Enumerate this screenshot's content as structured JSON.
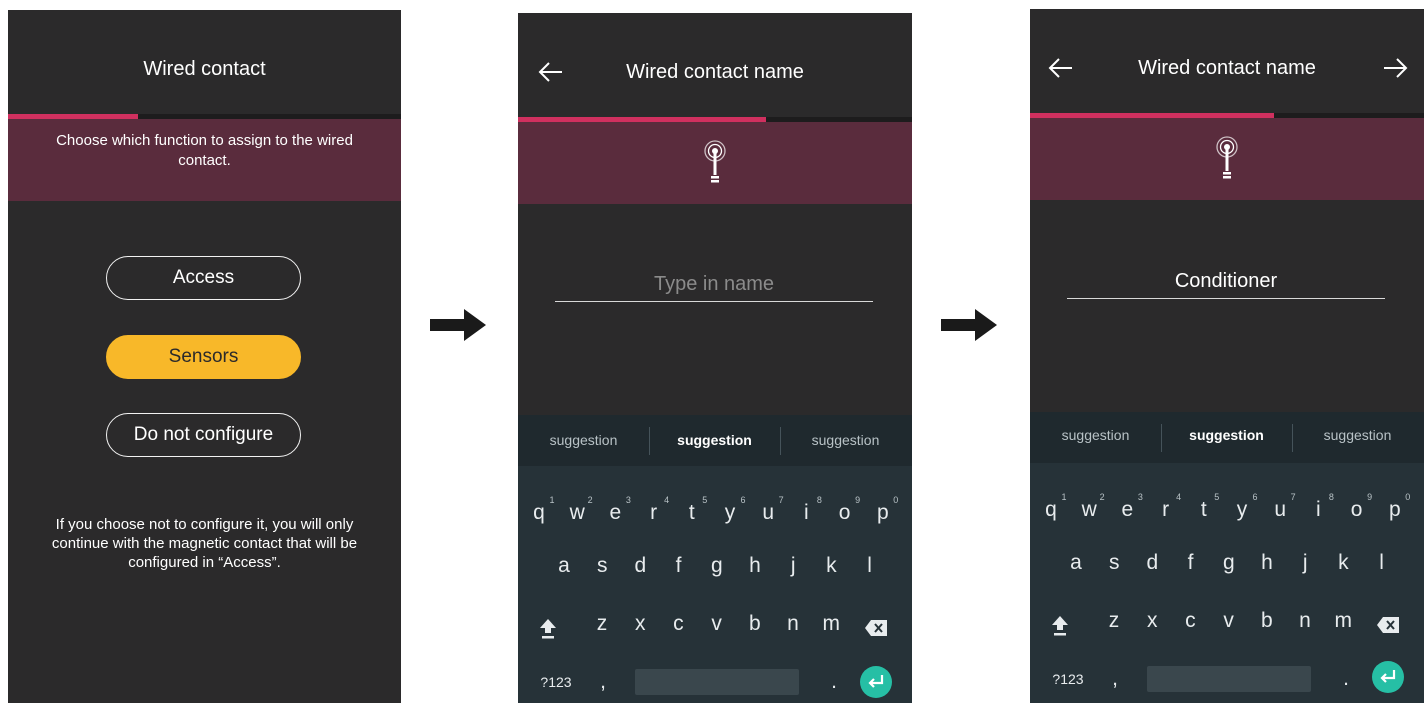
{
  "screens": [
    {
      "title": "Wired contact",
      "progress": 0.33,
      "instruction": "Choose which function to assign to the wired contact.",
      "options": [
        {
          "label": "Access",
          "selected": false
        },
        {
          "label": "Sensors",
          "selected": true
        },
        {
          "label": "Do not configure",
          "selected": false
        }
      ],
      "note": "If you choose not to configure it, you will only continue with the magnetic contact that will be configured in “Access”."
    },
    {
      "title": "Wired contact name",
      "progress": 0.63,
      "back_icon": "arrow-left-icon",
      "band_icon": "sensor-antenna-icon",
      "name_placeholder": "Type in name",
      "name_value": ""
    },
    {
      "title": "Wired contact name",
      "progress": 0.62,
      "back_icon": "arrow-left-icon",
      "next_icon": "arrow-right-icon",
      "band_icon": "sensor-antenna-icon",
      "name_placeholder": "Type in name",
      "name_value": "Conditioner"
    }
  ],
  "keyboard": {
    "suggestions": [
      "suggestion",
      "suggestion",
      "suggestion"
    ],
    "row1": [
      "q",
      "w",
      "e",
      "r",
      "t",
      "y",
      "u",
      "i",
      "o",
      "p"
    ],
    "row1_hints": [
      "1",
      "2",
      "3",
      "4",
      "5",
      "6",
      "7",
      "8",
      "9",
      "0"
    ],
    "row2": [
      "a",
      "s",
      "d",
      "f",
      "g",
      "h",
      "j",
      "k",
      "l"
    ],
    "row3": [
      "z",
      "x",
      "c",
      "v",
      "b",
      "n",
      "m"
    ],
    "symbols_label": "?123",
    "comma_label": ",",
    "period_label": ".",
    "shift_icon": "shift-icon",
    "backspace_icon": "backspace-icon",
    "enter_icon": "enter-icon"
  },
  "flow_arrows": [
    "arrow-right-icon",
    "arrow-right-icon"
  ],
  "colors": {
    "screen_bg": "#2b2a2b",
    "accent_pink": "#d0305f",
    "band": "#5a2c3d",
    "selected_pill": "#f8b829",
    "keyboard_bg": "#263238",
    "enter_key": "#26bfa5"
  }
}
